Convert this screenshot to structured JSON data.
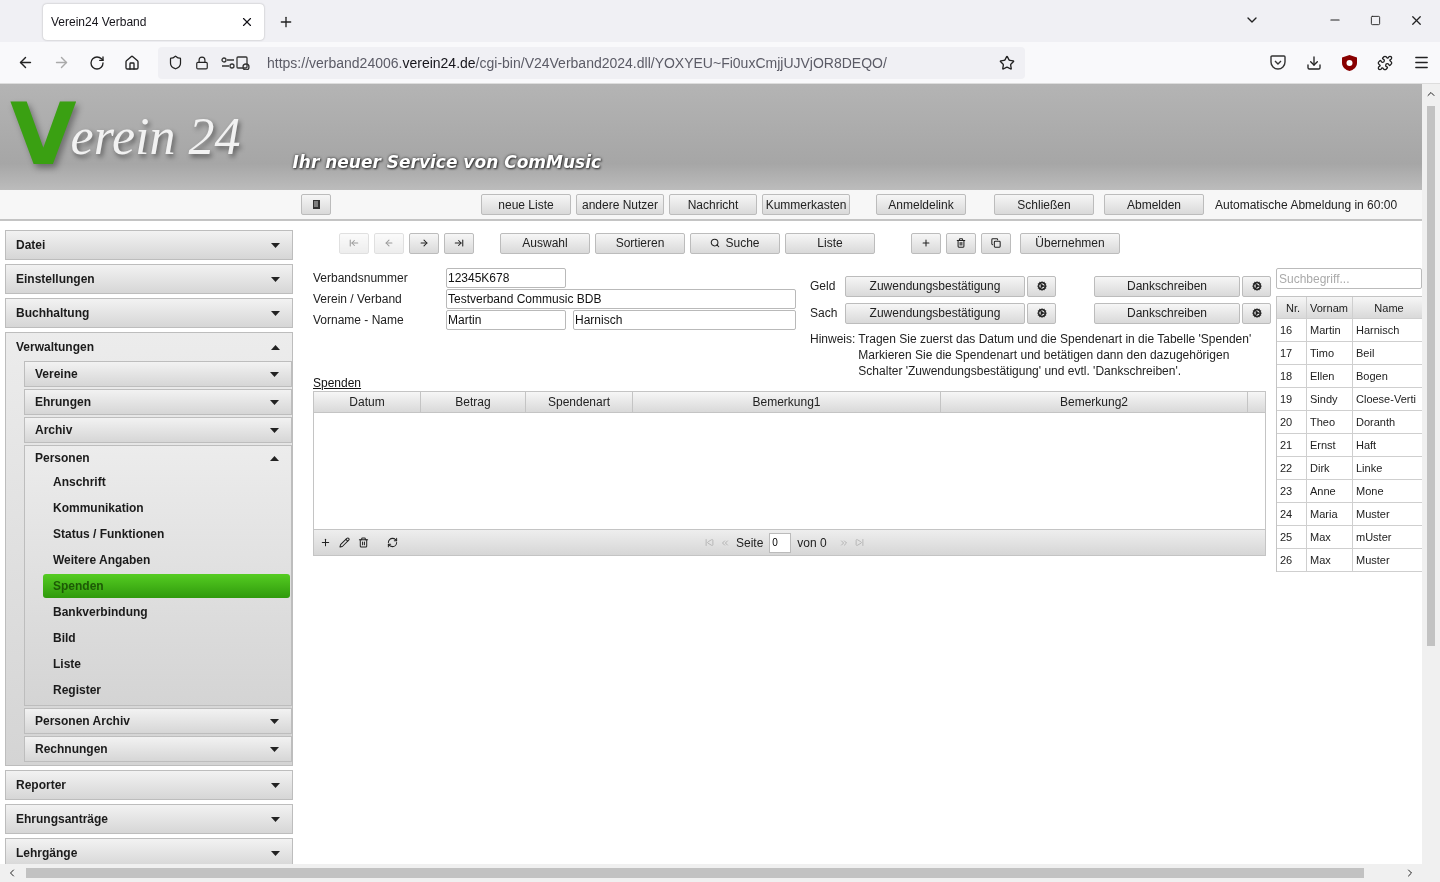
{
  "browser": {
    "tab_title": "Verein24 Verband",
    "url_start": "https://verband24006.",
    "url_domain": "verein24.de",
    "url_path": "/cgi-bin/V24Verband2024.dll/YOXYEU~Fi0uxCmjjUJVjOR8DEQO/"
  },
  "header": {
    "logo_initial": "V",
    "logo_rest": "erein 24",
    "tagline": "Ihr neuer Service von ComMusic"
  },
  "top_toolbar": {
    "button_groups": [
      [
        "neue Liste",
        "andere Nutzer",
        "Nachricht",
        "Kummerkasten"
      ],
      [
        "Anmeldelink"
      ],
      [
        "Schließen"
      ],
      [
        "Abmelden"
      ]
    ],
    "logout_notice": "Automatische Abmeldung in 60:00"
  },
  "sidebar": {
    "items": [
      {
        "kind": "section",
        "label": "Datei",
        "expanded": false
      },
      {
        "kind": "section",
        "label": "Einstellungen",
        "expanded": false
      },
      {
        "kind": "section",
        "label": "Buchhaltung",
        "expanded": false
      },
      {
        "kind": "section",
        "label": "Verwaltungen",
        "expanded": true,
        "children": [
          {
            "kind": "section",
            "label": "Vereine",
            "expanded": false
          },
          {
            "kind": "section",
            "label": "Ehrungen",
            "expanded": false
          },
          {
            "kind": "section",
            "label": "Archiv",
            "expanded": false
          },
          {
            "kind": "section",
            "label": "Personen",
            "expanded": true,
            "children": [
              {
                "kind": "link",
                "label": "Anschrift",
                "selected": false
              },
              {
                "kind": "link",
                "label": "Kommunikation",
                "selected": false
              },
              {
                "kind": "link",
                "label": "Status / Funktionen",
                "selected": false
              },
              {
                "kind": "link",
                "label": "Weitere Angaben",
                "selected": false
              },
              {
                "kind": "link",
                "label": "Spenden",
                "selected": true
              },
              {
                "kind": "link",
                "label": "Bankverbindung",
                "selected": false
              },
              {
                "kind": "link",
                "label": "Bild",
                "selected": false
              },
              {
                "kind": "link",
                "label": "Liste",
                "selected": false
              },
              {
                "kind": "link",
                "label": "Register",
                "selected": false
              }
            ]
          },
          {
            "kind": "section",
            "label": "Personen Archiv",
            "expanded": false
          },
          {
            "kind": "section",
            "label": "Rechnungen",
            "expanded": false
          }
        ]
      },
      {
        "kind": "section",
        "label": "Reporter",
        "expanded": false
      },
      {
        "kind": "section",
        "label": "Ehrungsanträge",
        "expanded": false
      },
      {
        "kind": "section",
        "label": "Lehrgänge",
        "expanded": false
      }
    ]
  },
  "record_toolbar": {
    "nav_buttons": [
      {
        "kind": "first",
        "disabled": true
      },
      {
        "kind": "prev",
        "disabled": true
      },
      {
        "kind": "next",
        "disabled": false
      },
      {
        "kind": "last",
        "disabled": false
      }
    ],
    "action_buttons": [
      {
        "kind": "plain",
        "label": "Auswahl"
      },
      {
        "kind": "plain",
        "label": "Sortieren"
      },
      {
        "kind": "search",
        "label": "Suche"
      },
      {
        "kind": "plain",
        "label": "Liste"
      }
    ],
    "edit_buttons": [
      {
        "kind": "add"
      },
      {
        "kind": "delete"
      },
      {
        "kind": "copy"
      }
    ],
    "apply_label": "Übernehmen"
  },
  "form": {
    "fields": [
      {
        "kind": "short",
        "label": "Verbandsnummer",
        "values": [
          "12345K678"
        ]
      },
      {
        "kind": "wide",
        "label": "Verein / Verband",
        "values": [
          "Testverband Commusic BDB"
        ]
      },
      {
        "kind": "pair",
        "label": "Vorname - Name",
        "values": [
          "Martin",
          "Harnisch"
        ]
      }
    ]
  },
  "documents": {
    "rows": [
      {
        "label": "Geld",
        "certificate": "Zuwendungsbestätigung",
        "letter": "Dankschreiben"
      },
      {
        "label": "Sach",
        "certificate": "Zuwendungsbestätigung",
        "letter": "Dankschreiben"
      }
    ],
    "hint_label": "Hinweis:",
    "hint_lines": [
      "Tragen Sie zuerst das Datum und die Spendenart in die Tabelle 'Spenden'",
      "Markieren Sie die Spendenart und betätigen dann den dazugehörigen",
      "Schalter 'Zuwendungsbestätigung' und evtl. 'Dankschreiben'."
    ]
  },
  "donations": {
    "title": "Spenden",
    "columns": [
      "Datum",
      "Betrag",
      "Spendenart",
      "Bemerkung1",
      "Bemerkung2"
    ],
    "page_label": "Seite",
    "page_value": "0",
    "of_label": "von 0"
  },
  "people": {
    "search_placeholder": "Suchbegriff...",
    "columns": [
      "Nr.",
      "Vornam",
      "Name"
    ],
    "rows": [
      [
        "16",
        "Martin",
        "Harnisch"
      ],
      [
        "17",
        "Timo",
        "Beil"
      ],
      [
        "18",
        "Ellen",
        "Bogen"
      ],
      [
        "19",
        "Sindy",
        "Cloese-Verti"
      ],
      [
        "20",
        "Theo",
        "Doranth"
      ],
      [
        "21",
        "Ernst",
        "Haft"
      ],
      [
        "22",
        "Dirk",
        "Linke"
      ],
      [
        "23",
        "Anne",
        "Mone"
      ],
      [
        "24",
        "Maria",
        "Muster"
      ],
      [
        "25",
        "Max",
        "mUster"
      ],
      [
        "26",
        "Max",
        "Muster"
      ]
    ]
  }
}
